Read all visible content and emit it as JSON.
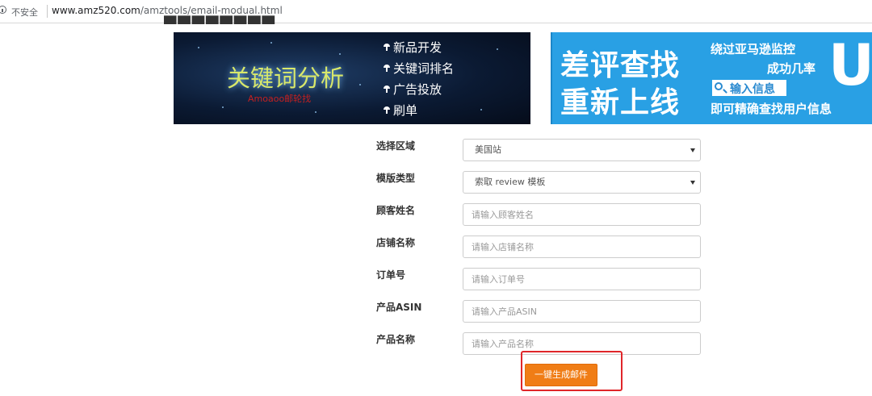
{
  "browser": {
    "security_label": "不安全",
    "url_domain": "www.amz520.com",
    "url_path": "/amztools/email-modual.html"
  },
  "banner_keyword": {
    "title": "关键词分析",
    "subtitle": "Amoaoo邮轮找",
    "items": [
      "新品开发",
      "关键词排名",
      "广告投放",
      "刷单"
    ]
  },
  "banner_review": {
    "line1": "差评查找",
    "line2": "重新上线",
    "right_line1": "绕过亚马逊监控",
    "right_line2": "成功几率",
    "search_text": "输入信息",
    "right_line3": "即可精确查找用户信息",
    "logo": "U"
  },
  "form": {
    "region": {
      "label": "选择区域",
      "value": "美国站"
    },
    "template": {
      "label": "模版类型",
      "value": "索取 review 模板"
    },
    "customer_name": {
      "label": "顾客姓名",
      "placeholder": "请输入顾客姓名"
    },
    "store_name": {
      "label": "店铺名称",
      "placeholder": "请输入店铺名称"
    },
    "order_id": {
      "label": "订单号",
      "placeholder": "请输入订单号"
    },
    "asin": {
      "label": "产品ASIN",
      "placeholder": "请输入产品ASIN"
    },
    "product_name": {
      "label": "产品名称",
      "placeholder": "请输入产品名称"
    },
    "submit_label": "一键生成邮件"
  },
  "colors": {
    "button_orange": "#f07d16",
    "highlight_red": "#e0262a",
    "banner_blue": "#29a0e4"
  }
}
